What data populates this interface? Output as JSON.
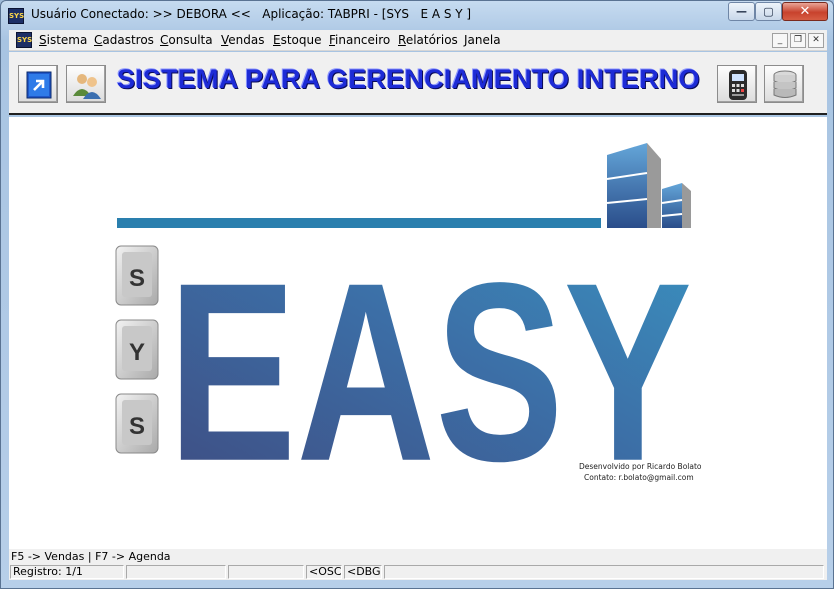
{
  "window": {
    "title": "Usuário Conectado: >> DEBORA <<   Aplicação: TABPRI - [SYS   E A S Y ]",
    "app_icon_text": "SYS",
    "controls": {
      "minimize": "—",
      "maximize": "▢",
      "close": "✕"
    }
  },
  "menu": {
    "items": [
      {
        "label": "Sistema",
        "accel": "S"
      },
      {
        "label": "Cadastros",
        "accel": "C"
      },
      {
        "label": "Consulta",
        "accel": "C"
      },
      {
        "label": "Vendas",
        "accel": "V"
      },
      {
        "label": "Estoque",
        "accel": "E"
      },
      {
        "label": "Financeiro",
        "accel": "F"
      },
      {
        "label": "Relatórios",
        "accel": "R"
      },
      {
        "label": "Janela",
        "accel": ""
      }
    ],
    "mdi_controls": {
      "minimize": "_",
      "restore": "❐",
      "close": "✕"
    }
  },
  "toolbar": {
    "headline": "SISTEMA PARA GERENCIAMENTO INTERNO",
    "left_icons": [
      "exit-icon",
      "users-icon"
    ],
    "right_icons": [
      "calculator-icon",
      "database-icon"
    ]
  },
  "logo": {
    "side_letters": [
      "S",
      "Y",
      "S"
    ],
    "word": "EASY",
    "credit_line1": "Desenvolvido por Ricardo Bolato",
    "credit_line2": "Contato:  r.bolato@gmail.com",
    "colors": {
      "blue_dark": "#3f5287",
      "blue_light": "#3a8ab8",
      "bar": "#2a7fae"
    }
  },
  "hint": "F5 -> Vendas | F7 -> Agenda",
  "status": {
    "registro": "Registro: 1/1",
    "osc": "<OSC>",
    "dbg": "<DBG>"
  }
}
